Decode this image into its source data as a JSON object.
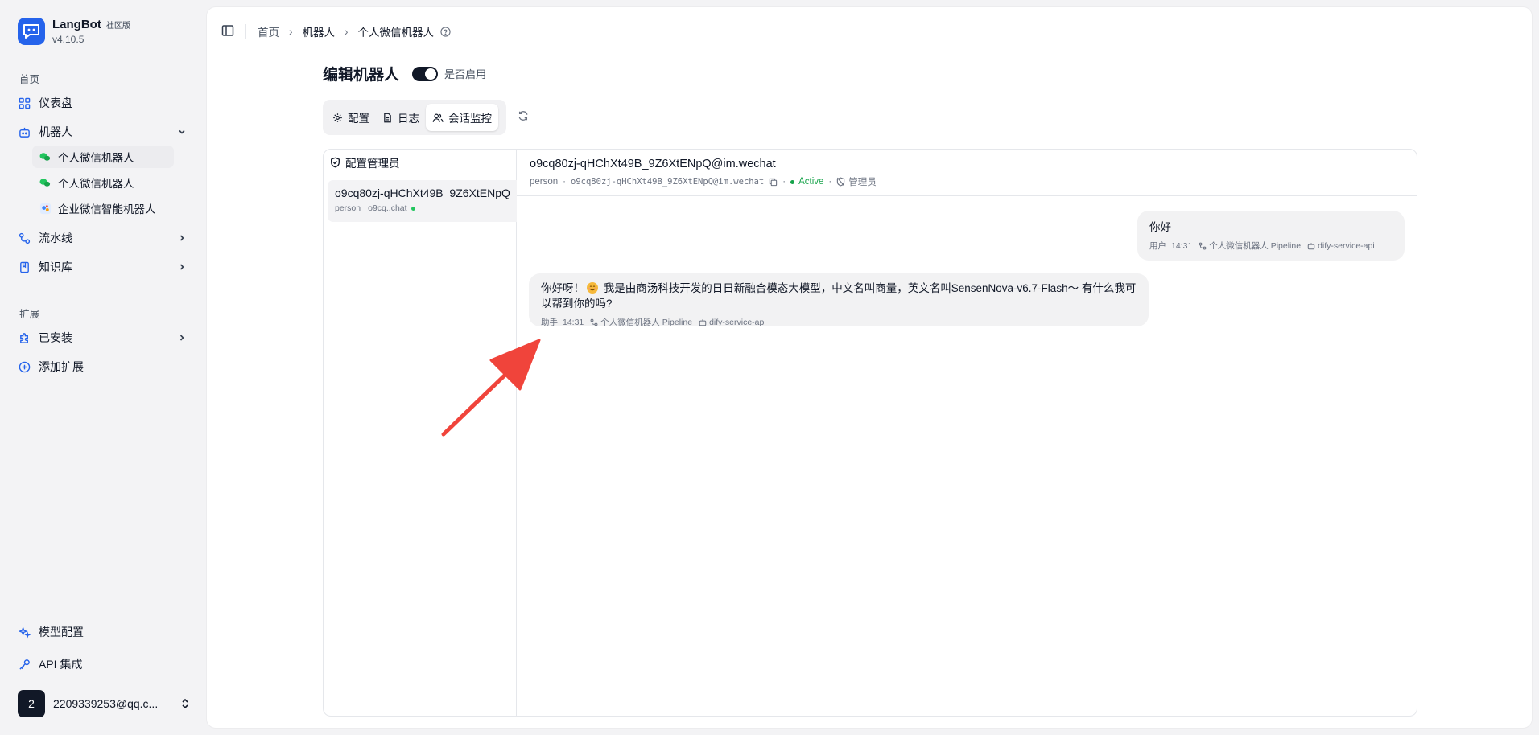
{
  "brand": {
    "name": "LangBot",
    "edition": "社区版",
    "version": "v4.10.5"
  },
  "sidebar": {
    "section_home": "首页",
    "dashboard": "仪表盘",
    "bots": "机器人",
    "bot_items": [
      {
        "label": "个人微信机器人",
        "icon": "wechat-icon"
      },
      {
        "label": "个人微信机器人",
        "icon": "wechat-icon"
      },
      {
        "label": "企业微信智能机器人",
        "icon": "wecom-icon"
      }
    ],
    "pipelines": "流水线",
    "knowledge": "知识库",
    "section_extensions": "扩展",
    "installed": "已安装",
    "add_extension": "添加扩展",
    "model_config": "模型配置",
    "api": "API 集成",
    "user": {
      "avatar": "2",
      "email": "2209339253@qq.c..."
    }
  },
  "breadcrumb": {
    "home": "首页",
    "bots": "机器人",
    "current": "个人微信机器人"
  },
  "page": {
    "title": "编辑机器人",
    "enabled_label": "是否启用",
    "enabled": true
  },
  "tabs": [
    {
      "label": "配置",
      "icon": "gear-icon",
      "active": false
    },
    {
      "label": "日志",
      "icon": "file-icon",
      "active": false
    },
    {
      "label": "会话监控",
      "icon": "users-icon",
      "active": true
    }
  ],
  "sessions": {
    "header": "配置管理员",
    "items": [
      {
        "title": "o9cq80zj-qHChXt49B_9Z6XtENpQ",
        "type": "person",
        "short": "o9cq..chat",
        "online": true
      }
    ]
  },
  "conversation": {
    "title": "o9cq80zj-qHChXt49B_9Z6XtENpQ@im.wechat",
    "type": "person",
    "id": "o9cq80zj-qHChXt49B_9Z6XtENpQ@im.wechat",
    "status": "Active",
    "admin": "管理员",
    "messages": [
      {
        "role": "user",
        "text": "你好",
        "sender": "用户",
        "time": "14:31",
        "pipeline": "个人微信机器人 Pipeline",
        "runner": "dify-service-api"
      },
      {
        "role": "assistant",
        "text_before": "你好呀！",
        "text_after": " 我是由商汤科技开发的日日新融合模态大模型，中文名叫商量，英文名叫SensenNova-v6.7-Flash～ 有什么我可以帮到你的吗?",
        "sender": "助手",
        "time": "14:31",
        "pipeline": "个人微信机器人 Pipeline",
        "runner": "dify-service-api"
      }
    ]
  },
  "colors": {
    "accent": "#2563eb",
    "active": "#16a34a",
    "annotation_arrow": "#f0443b"
  }
}
